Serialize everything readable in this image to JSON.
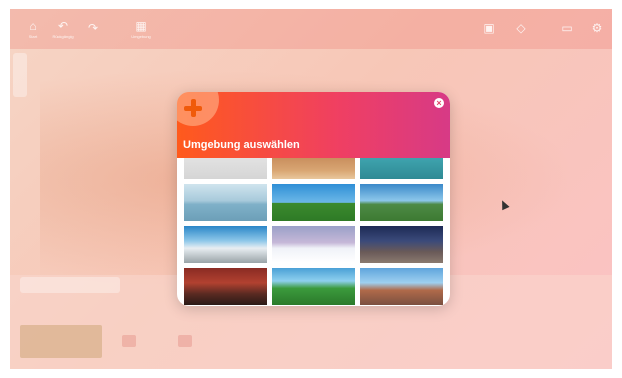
{
  "background": {
    "title_bar_text": "",
    "toolbar_left": [
      {
        "label": "Start"
      },
      {
        "label": "Rückgängig"
      },
      {
        "label": ""
      },
      {
        "label": "Umgebung"
      }
    ],
    "toolbar_right": [
      {
        "label": ""
      },
      {
        "label": ""
      },
      {
        "label": ""
      },
      {
        "label": ""
      }
    ]
  },
  "dialog": {
    "title": "Umgebung auswählen",
    "close_glyph": "×",
    "icon": "plus-icon",
    "accent_colors": [
      "#ff5a1c",
      "#ef3f63",
      "#d73a86"
    ],
    "thumbnails": [
      {
        "name": "fog"
      },
      {
        "name": "desert"
      },
      {
        "name": "teal"
      },
      {
        "name": "sea"
      },
      {
        "name": "field"
      },
      {
        "name": "hills"
      },
      {
        "name": "snow-mountains"
      },
      {
        "name": "winter"
      },
      {
        "name": "town"
      },
      {
        "name": "room"
      },
      {
        "name": "valley"
      },
      {
        "name": "city"
      }
    ]
  }
}
